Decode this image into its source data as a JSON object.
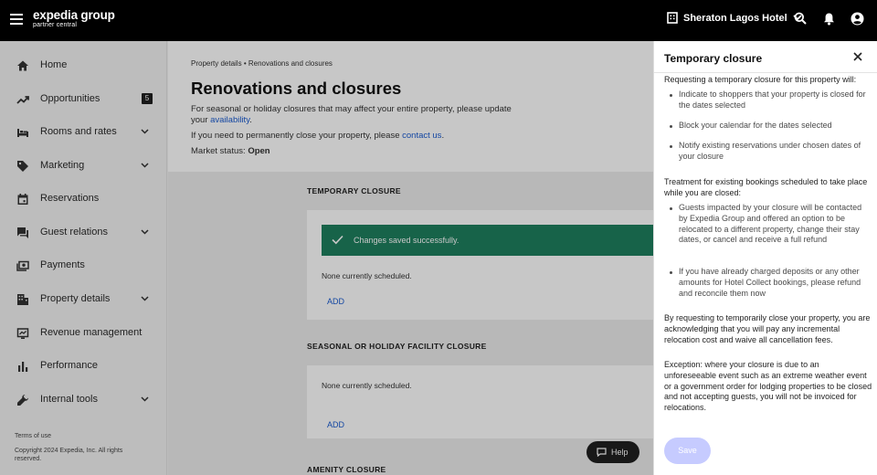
{
  "header": {
    "logo_main": "expedia group",
    "logo_sub": "partner central",
    "hotel_name": "Sheraton Lagos Hotel",
    "icons": [
      "menu-icon",
      "hotel-icon",
      "chevron-down-icon",
      "search-icon",
      "bell-icon",
      "account-icon"
    ]
  },
  "sidebar": {
    "items": [
      {
        "label": "Home",
        "icon": "home-icon"
      },
      {
        "label": "Opportunities",
        "icon": "trending-icon",
        "badge": "5"
      },
      {
        "label": "Rooms and rates",
        "icon": "bed-icon",
        "expandable": true
      },
      {
        "label": "Marketing",
        "icon": "tag-icon",
        "expandable": true
      },
      {
        "label": "Reservations",
        "icon": "calendar-icon"
      },
      {
        "label": "Guest relations",
        "icon": "chat-icon",
        "expandable": true
      },
      {
        "label": "Payments",
        "icon": "payments-icon"
      },
      {
        "label": "Property details",
        "icon": "building-icon",
        "expandable": true
      },
      {
        "label": "Revenue management",
        "icon": "revenue-icon"
      },
      {
        "label": "Performance",
        "icon": "bar-chart-icon"
      },
      {
        "label": "Internal tools",
        "icon": "wrench-icon",
        "expandable": true
      }
    ],
    "terms": "Terms of use",
    "copyright_line1": "Copyright 2024 Expedia, Inc. All rights",
    "copyright_line2": "reserved."
  },
  "main": {
    "breadcrumb_parent": "Property details",
    "breadcrumb_sep": "•",
    "breadcrumb_current": "Renovations and closures",
    "title": "Renovations and closures",
    "intro_text": "For seasonal or holiday closures that may affect your entire property, please update your",
    "intro_link": "availability",
    "permanent_text": "If you need to permanently close your property, please",
    "permanent_link": "contact us",
    "market_status_label": "Market status:",
    "market_status_value": "Open",
    "temporary_heading": "TEMPORARY CLOSURE",
    "toast_text": "Changes saved successfully.",
    "none_scheduled_1": "None currently scheduled.",
    "add_1": "ADD",
    "seasonal_heading": "SEASONAL OR HOLIDAY FACILITY CLOSURE",
    "none_scheduled_2": "None currently scheduled.",
    "add_2": "ADD",
    "amenity_heading": "AMENITY CLOSURE",
    "help_label": "Help"
  },
  "panel": {
    "title": "Temporary closure",
    "intro": "Requesting a temporary closure for this property will:",
    "bullets_1": [
      "Indicate to shoppers that your property is closed for the dates selected",
      "Block your calendar for the dates selected",
      "Notify existing reservations under chosen dates of your closure"
    ],
    "treatment_heading": "Treatment for existing bookings scheduled to take place while you are closed:",
    "bullets_2": [
      "Guests impacted by your closure will be contacted by Expedia Group and offered an option to be relocated to a different property, change their stay dates, or cancel and receive a full refund",
      "If you have already charged deposits or any other amounts for Hotel Collect bookings, please refund and reconcile them now"
    ],
    "acknowledge": "By requesting to temporarily close your property, you are acknowledging that you will pay any incremental relocation cost and waive all cancellation fees.",
    "exception": "Exception: where your closure is due to an unforeseeable event such as an extreme weather event or a government order for lodging properties to be closed and not accepting guests, you will not be invoiced for relocations.",
    "save_label": "Save"
  },
  "colors": {
    "topbar": "#000000",
    "toast": "#1e7f5e",
    "link": "#1a5bd0",
    "save_disabled": "#c6cbff"
  }
}
